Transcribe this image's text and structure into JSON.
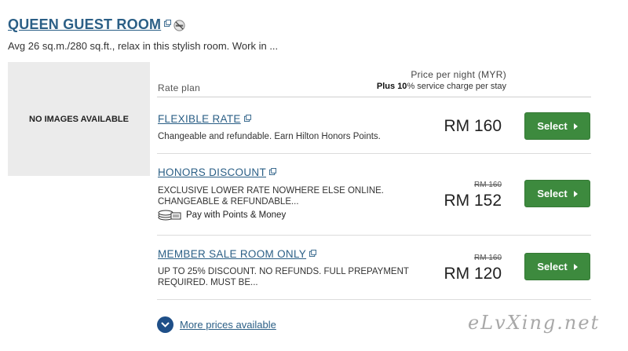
{
  "room": {
    "title": "QUEEN GUEST ROOM",
    "description": "Avg 26 sq.m./280 sq.ft., relax in this stylish room. Work in ...",
    "no_image_text": "NO IMAGES AVAILABLE"
  },
  "header": {
    "rate_plan_label": "Rate plan",
    "price_label": "Price per night (MYR)",
    "service_charge_bold": "Plus 10",
    "service_charge_rest": "% service charge per stay"
  },
  "rates": [
    {
      "name": "FLEXIBLE RATE",
      "description": "Changeable and refundable. Earn Hilton Honors Points.",
      "price": "RM 160",
      "button_label": "Select"
    },
    {
      "name": "HONORS DISCOUNT",
      "description_line1": "EXCLUSIVE LOWER RATE NOWHERE ELSE ONLINE.",
      "description_line2": "CHANGEABLE & REFUNDABLE...",
      "points_text": "Pay with Points & Money",
      "original_price": "RM 160",
      "price": "RM 152",
      "button_label": "Select"
    },
    {
      "name": "MEMBER SALE ROOM ONLY",
      "description_line1": "UP TO 25% DISCOUNT. NO REFUNDS. FULL PREPAYMENT",
      "description_line2": "REQUIRED. MUST BE...",
      "original_price": "RM 160",
      "price": "RM 120",
      "button_label": "Select"
    }
  ],
  "more_prices_label": "More prices available",
  "watermark": "eLvXing.net",
  "colors": {
    "link": "#2b5f86",
    "button": "#3d8a3e",
    "more_circle": "#1f4f88"
  },
  "icons": [
    "external-link-icon",
    "no-smoking-icon",
    "coins-icon",
    "chevron-right-icon",
    "chevron-down-icon"
  ]
}
